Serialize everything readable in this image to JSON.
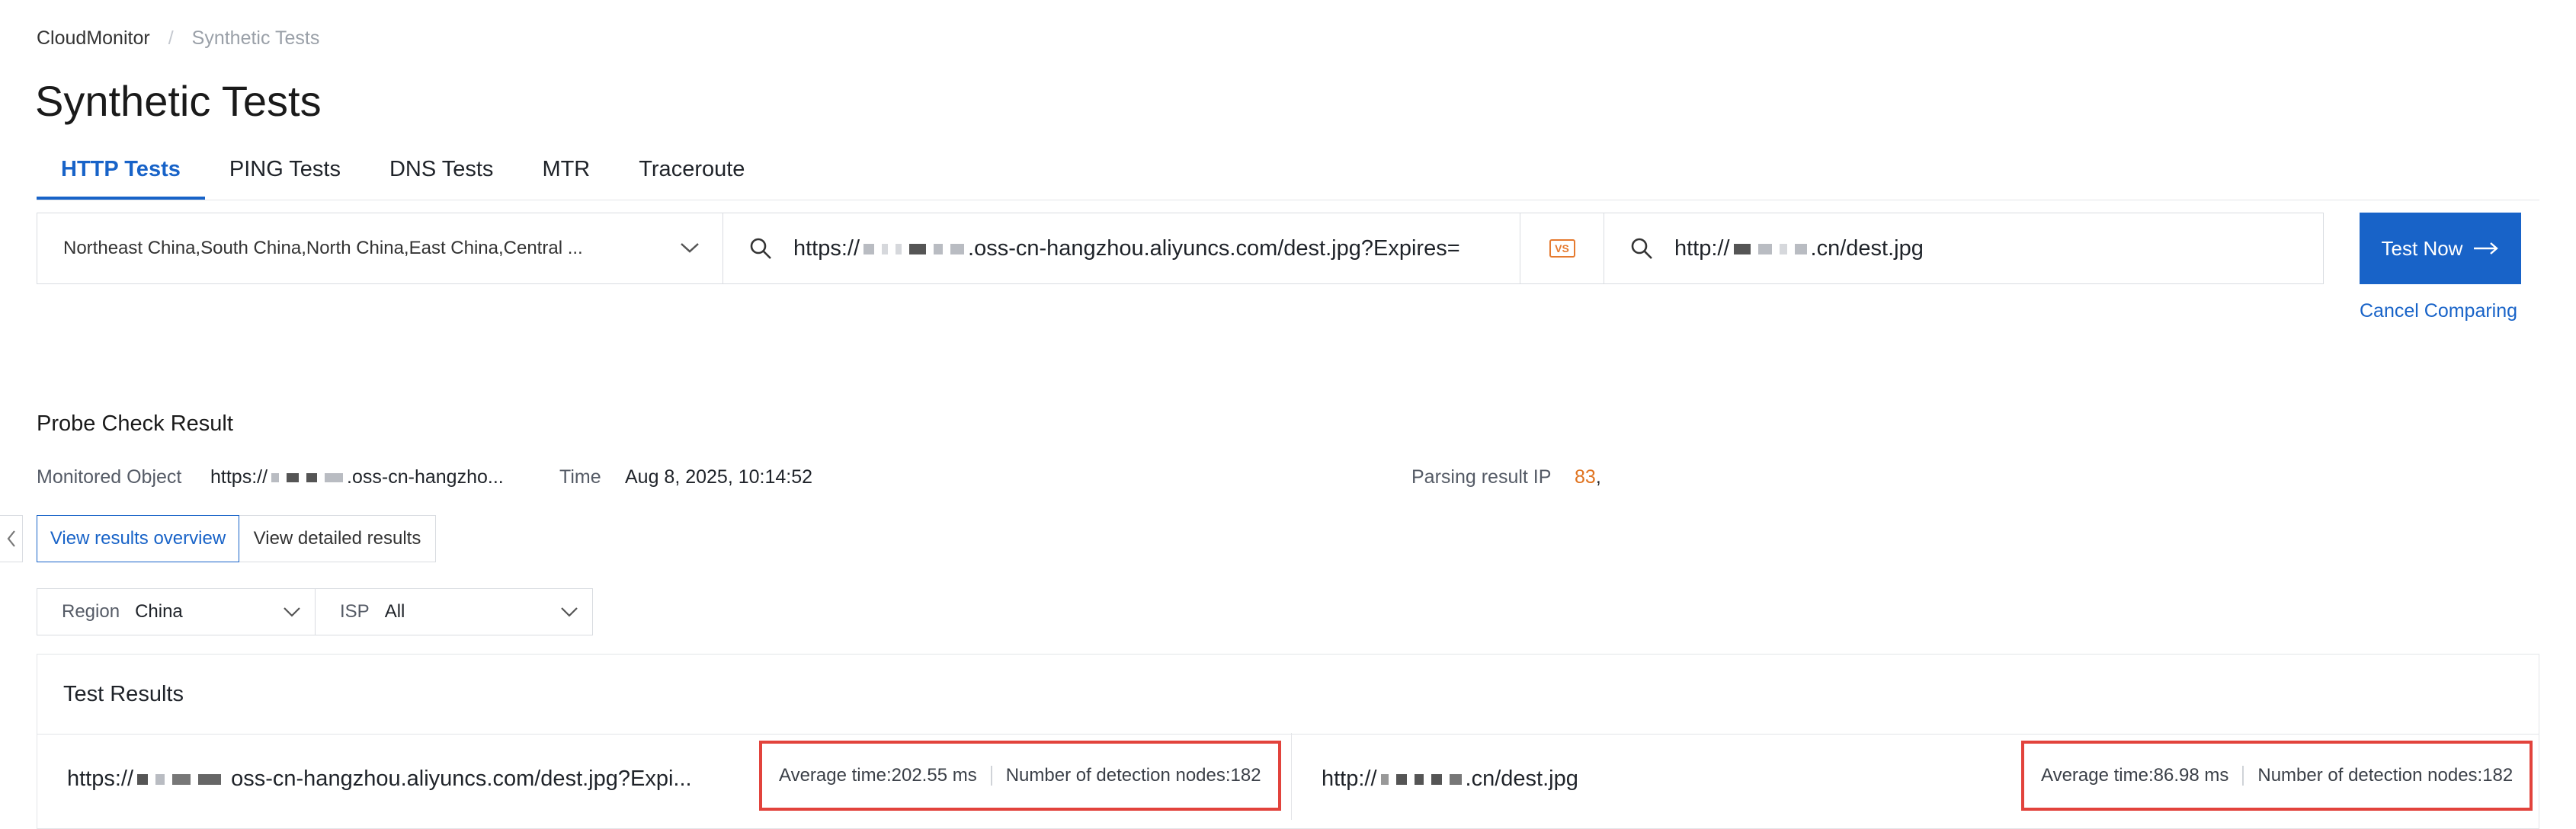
{
  "breadcrumb": {
    "root": "CloudMonitor",
    "sep": "/",
    "current": "Synthetic Tests"
  },
  "page_title": "Synthetic Tests",
  "tabs": [
    {
      "label": "HTTP Tests",
      "active": true
    },
    {
      "label": "PING Tests",
      "active": false
    },
    {
      "label": "DNS Tests",
      "active": false
    },
    {
      "label": "MTR",
      "active": false
    },
    {
      "label": "Traceroute",
      "active": false
    }
  ],
  "query": {
    "regions": "Northeast China,South China,North China,East China,Central ...",
    "url1_prefix": "https://",
    "url1_suffix": ".oss-cn-hangzhou.aliyuncs.com/dest.jpg?Expires=",
    "vs_label": "VS",
    "url2_prefix": "http://",
    "url2_suffix": ".cn/dest.jpg",
    "test_now": "Test Now",
    "cancel_comparing": "Cancel Comparing"
  },
  "probe": {
    "title": "Probe Check Result",
    "monitored_label": "Monitored Object",
    "monitored_prefix": "https://",
    "monitored_suffix": ".oss-cn-hangzho...",
    "time_label": "Time",
    "time_value": "Aug 8, 2025, 10:14:52",
    "parsing_label": "Parsing result IP",
    "parsing_value": "83",
    "parsing_tail": ","
  },
  "view": {
    "overview": "View results overview",
    "detailed": "View detailed results"
  },
  "filters": {
    "region_label": "Region",
    "region_value": "China",
    "isp_label": "ISP",
    "isp_value": "All"
  },
  "results": {
    "title": "Test Results",
    "left": {
      "url_prefix": "https://",
      "url_suffix": "oss-cn-hangzhou.aliyuncs.com/dest.jpg?Expi...",
      "avg": "Average time:202.55 ms",
      "nodes": "Number of detection nodes:182"
    },
    "right": {
      "url_prefix": "http://",
      "url_suffix": ".cn/dest.jpg",
      "avg": "Average time:86.98 ms",
      "nodes": "Number of detection nodes:182"
    }
  },
  "colors": {
    "accent": "#1863c8",
    "highlight": "#e2433c",
    "ip": "#e0731f",
    "vs": "#e57a2f"
  }
}
